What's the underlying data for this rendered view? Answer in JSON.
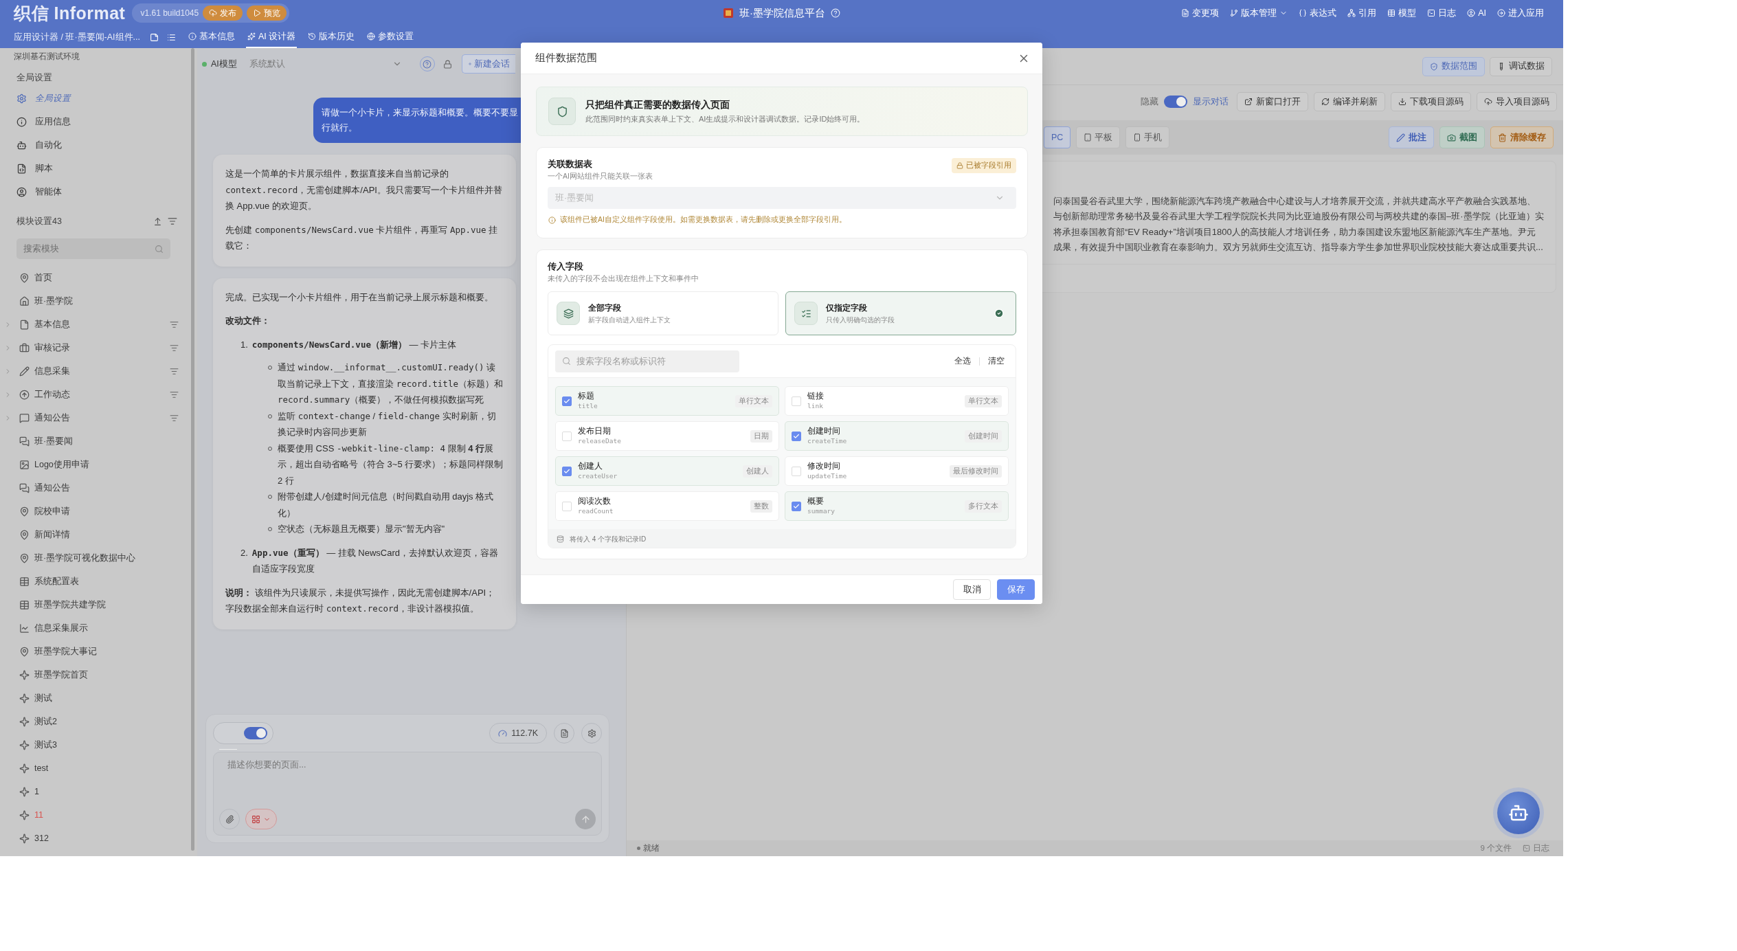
{
  "header": {
    "logo": "织信 Informat",
    "version": "v1.61 build1045",
    "quick_actions": [
      "发布",
      "预览"
    ],
    "app_title": "班·墨学院信息平台",
    "menu": [
      {
        "label": "变更项",
        "dropdown": false
      },
      {
        "label": "版本管理",
        "dropdown": true
      },
      {
        "label": "表达式",
        "dropdown": false
      },
      {
        "label": "引用",
        "dropdown": false
      },
      {
        "label": "模型",
        "dropdown": false
      },
      {
        "label": "日志",
        "dropdown": false
      },
      {
        "label": "AI",
        "dropdown": false
      },
      {
        "label": "进入应用",
        "dropdown": false
      }
    ],
    "breadcrumb": "应用设计器 / 班·墨要闻-AI组件...",
    "tabs": [
      {
        "label": "基本信息",
        "selected": false
      },
      {
        "label": "AI 设计器",
        "selected": true
      },
      {
        "label": "版本历史",
        "selected": false
      },
      {
        "label": "参数设置",
        "selected": false
      }
    ]
  },
  "sidebar": {
    "environment": "深圳基石测试环境",
    "global_title": "全局设置",
    "global_items": [
      {
        "label": "全局设置",
        "selected": true
      },
      {
        "label": "应用信息",
        "selected": false
      },
      {
        "label": "自动化",
        "selected": false
      },
      {
        "label": "脚本",
        "selected": false
      },
      {
        "label": "智能体",
        "selected": false
      }
    ],
    "module_title": "模块设置43",
    "search_placeholder": "搜索模块",
    "modules": [
      {
        "label": "首页",
        "kind": "page",
        "expandable": false
      },
      {
        "label": "班·墨学院",
        "kind": "home",
        "expandable": false
      },
      {
        "label": "基本信息",
        "kind": "form",
        "expandable": true
      },
      {
        "label": "审核记录",
        "kind": "audit",
        "expandable": true
      },
      {
        "label": "信息采集",
        "kind": "collect",
        "expandable": true
      },
      {
        "label": "工作动态",
        "kind": "activity",
        "expandable": true
      },
      {
        "label": "通知公告",
        "kind": "notice",
        "expandable": true
      },
      {
        "label": "班·墨要闻",
        "kind": "news",
        "expandable": false
      },
      {
        "label": "Logo使用申请",
        "kind": "image",
        "expandable": false
      },
      {
        "label": "通知公告",
        "kind": "news",
        "expandable": false
      },
      {
        "label": "院校申请",
        "kind": "page",
        "expandable": false
      },
      {
        "label": "新闻详情",
        "kind": "page",
        "expandable": false
      },
      {
        "label": "班·墨学院可视化数据中心",
        "kind": "page",
        "expandable": false
      },
      {
        "label": "系统配置表",
        "kind": "table",
        "expandable": false
      },
      {
        "label": "班墨学院共建学院",
        "kind": "table",
        "expandable": false
      },
      {
        "label": "信息采集展示",
        "kind": "chart",
        "expandable": false
      },
      {
        "label": "班墨学院大事记",
        "kind": "page",
        "expandable": false
      },
      {
        "label": "班墨学院首页",
        "kind": "custom",
        "expandable": false
      },
      {
        "label": "测试",
        "kind": "custom",
        "expandable": false
      },
      {
        "label": "测试2",
        "kind": "custom",
        "expandable": false
      },
      {
        "label": "测试3",
        "kind": "custom",
        "expandable": false
      },
      {
        "label": "test",
        "kind": "custom",
        "expandable": false
      },
      {
        "label": "1",
        "kind": "custom",
        "expandable": false
      },
      {
        "label": "11",
        "kind": "custom",
        "expandable": false,
        "color": "#d9534f"
      },
      {
        "label": "312",
        "kind": "custom",
        "expandable": false
      }
    ]
  },
  "chat": {
    "model_label": "AI模型",
    "model_value": "系统默认",
    "new_chat": "新建会话",
    "user_message": [
      "请做一个小卡片，来显示标题和概要。概要不要显",
      "行就行。"
    ],
    "assistant_messages": [
      {
        "blocks": [
          {
            "kind": "paragraph",
            "parts": [
              {
                "kind": "text",
                "text": "这是一个简单的卡片展示组件，数据直接来自当前记录的 "
              },
              {
                "kind": "code",
                "text": "context.record"
              },
              {
                "kind": "text",
                "text": "，无需创建脚本/API。我只需要写一个卡片组件并替换 App.vue 的欢迎页。"
              }
            ]
          },
          {
            "kind": "paragraph",
            "parts": [
              {
                "kind": "text",
                "text": "先创建 "
              },
              {
                "kind": "code",
                "text": "components/NewsCard.vue"
              },
              {
                "kind": "text",
                "text": " 卡片组件，再重写 "
              },
              {
                "kind": "code",
                "text": "App.vue"
              },
              {
                "kind": "text",
                "text": " 挂载它："
              }
            ]
          }
        ]
      },
      {
        "blocks": [
          {
            "kind": "paragraph",
            "parts": [
              {
                "kind": "text",
                "text": "完成。已实现一个小卡片组件，用于在当前记录上展示标题和概要。"
              }
            ]
          },
          {
            "kind": "paragraph",
            "parts": [
              {
                "kind": "bold",
                "text": "改动文件："
              }
            ]
          },
          {
            "kind": "ordered_list",
            "items": [
              {
                "number": "1.",
                "parts": [
                  {
                    "kind": "bold_code",
                    "text": "components/NewsCard.vue"
                  },
                  {
                    "kind": "bold",
                    "text": "（新增）"
                  },
                  {
                    "kind": "text",
                    "text": " — 卡片主体"
                  }
                ],
                "bullets": [
                  {
                    "parts": [
                      {
                        "kind": "text",
                        "text": "通过 "
                      },
                      {
                        "kind": "code",
                        "text": "window.__informat__.customUI.ready()"
                      },
                      {
                        "kind": "text",
                        "text": " 读取当前记录上下文，直接渲染 "
                      },
                      {
                        "kind": "code",
                        "text": "record.title"
                      },
                      {
                        "kind": "text",
                        "text": "（标题）和 "
                      },
                      {
                        "kind": "code",
                        "text": "record.summary"
                      },
                      {
                        "kind": "text",
                        "text": "（概要），不做任何模拟数据写死"
                      }
                    ]
                  },
                  {
                    "parts": [
                      {
                        "kind": "text",
                        "text": "监听 "
                      },
                      {
                        "kind": "code",
                        "text": "context-change"
                      },
                      {
                        "kind": "text",
                        "text": " / "
                      },
                      {
                        "kind": "code",
                        "text": "field-change"
                      },
                      {
                        "kind": "text",
                        "text": " 实时刷新，切换记录时内容同步更新"
                      }
                    ]
                  },
                  {
                    "parts": [
                      {
                        "kind": "text",
                        "text": "概要使用 CSS "
                      },
                      {
                        "kind": "code",
                        "text": "-webkit-line-clamp: 4"
                      },
                      {
                        "kind": "text",
                        "text": " 限制 "
                      },
                      {
                        "kind": "bold",
                        "text": "4 行"
                      },
                      {
                        "kind": "text",
                        "text": "展示，超出自动省略号（符合 3~5 行要求）；标题同样限制 2 行"
                      }
                    ]
                  },
                  {
                    "parts": [
                      {
                        "kind": "text",
                        "text": "附带创建人/创建时间元信息（时间戳自动用 dayjs 格式化）"
                      }
                    ]
                  },
                  {
                    "parts": [
                      {
                        "kind": "text",
                        "text": "空状态（无标题且无概要）显示\"暂无内容\""
                      }
                    ]
                  }
                ]
              },
              {
                "number": "2.",
                "parts": [
                  {
                    "kind": "bold_code",
                    "text": "App.vue"
                  },
                  {
                    "kind": "bold",
                    "text": "（重写）"
                  },
                  {
                    "kind": "text",
                    "text": " — 挂载 NewsCard，去掉默认欢迎页，容器自适应字段宽度"
                  }
                ]
              }
            ]
          },
          {
            "kind": "paragraph",
            "parts": [
              {
                "kind": "bold",
                "text": "说明："
              },
              {
                "kind": "text",
                "text": " 该组件为只读展示，未提供写操作，因此无需创建脚本/API；字段数据全部来自运行时 "
              },
              {
                "kind": "code",
                "text": "context.record"
              },
              {
                "kind": "text",
                "text": "，非设计器模拟值。"
              }
            ]
          }
        ]
      }
    ],
    "toggle_on": true,
    "token_count": "112.7K",
    "placeholder": "描述你想要的页面..."
  },
  "preview": {
    "scope_buttons": [
      {
        "label": "数据范围",
        "selected": true
      },
      {
        "label": "调试数据",
        "selected": false
      }
    ],
    "hide_label": "隐藏",
    "show_chat": {
      "label": "显示对话",
      "on": true
    },
    "actions": [
      "新窗口打开",
      "编译并刷新",
      "下载项目源码",
      "导入项目源码"
    ],
    "devices": [
      {
        "label": "PC",
        "selected": true
      },
      {
        "label": "平板",
        "selected": false
      },
      {
        "label": "手机",
        "selected": false
      }
    ],
    "tools": [
      {
        "label": "批注",
        "kind": "annotate"
      },
      {
        "label": "截图",
        "kind": "screenshot"
      },
      {
        "label": "清除缓存",
        "kind": "clear"
      }
    ],
    "content_lines": [
      "问泰国曼谷吞武里大学，围绕新能源汽车跨境产教融合中心建设与人才培养展开交流，并就共建高水平产教融合实践基地、",
      "与创新部助理常务秘书及曼谷吞武里大学工程学院院长共同为比亚迪股份有限公司与两校共建的泰国–班·墨学院（比亚迪）实",
      "将承担泰国教育部“EV Ready+”培训项目1800人的高技能人才培训任务，助力泰国建设东盟地区新能源汽车生产基地。尹元",
      "成果，有效提升中国职业教育在泰影响力。双方另就师生交流互访、指导泰方学生参加世界职业院校技能大赛达成重要共识..."
    ],
    "status": "就绪",
    "file_count": "9 个文件",
    "log": "日志"
  },
  "modal": {
    "title": "组件数据范围",
    "banner": {
      "title": "只把组件真正需要的数据传入页面",
      "text": "此范围同时约束真实表单上下文、AI生成提示和设计器调试数据。记录ID始终可用。"
    },
    "table_section": {
      "title": "关联数据表",
      "subtitle": "一个AI网站组件只能关联一张表",
      "badge": "已被字段引用",
      "select_value": "班·墨要闻",
      "select_disabled": true,
      "warning": "该组件已被AI自定义组件字段使用。如需更换数据表，请先删除或更换全部字段引用。"
    },
    "fields_section": {
      "title": "传入字段",
      "subtitle": "未传入的字段不会出现在组件上下文和事件中",
      "modes": [
        {
          "kind": "all",
          "title": "全部字段",
          "text": "新字段自动进入组件上下文",
          "selected": false
        },
        {
          "kind": "specified",
          "title": "仅指定字段",
          "text": "只传入明确勾选的字段",
          "selected": true
        }
      ],
      "search_placeholder": "搜索字段名称或标识符",
      "select_all": "全选",
      "clear": "清空",
      "items": [
        {
          "name": "标题",
          "id": "title",
          "type": "单行文本",
          "checked": true
        },
        {
          "name": "链接",
          "id": "link",
          "type": "单行文本",
          "checked": false
        },
        {
          "name": "发布日期",
          "id": "releaseDate",
          "type": "日期",
          "checked": false
        },
        {
          "name": "创建时间",
          "id": "createTime",
          "type": "创建时间",
          "checked": true
        },
        {
          "name": "创建人",
          "id": "createUser",
          "type": "创建人",
          "checked": true
        },
        {
          "name": "修改时间",
          "id": "updateTime",
          "type": "最后修改时间",
          "checked": false
        },
        {
          "name": "阅读次数",
          "id": "readCount",
          "type": "整数",
          "checked": false
        },
        {
          "name": "概要",
          "id": "summary",
          "type": "多行文本",
          "checked": true
        }
      ],
      "summary": "将传入 4 个字段和记录ID"
    },
    "buttons": {
      "cancel": "取消",
      "save": "保存"
    }
  }
}
